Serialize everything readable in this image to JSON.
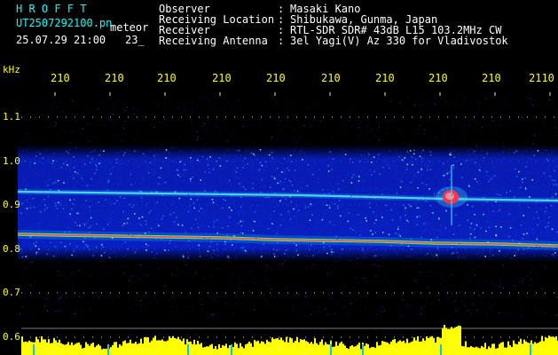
{
  "header": {
    "app_name": "H R O F F T",
    "filename": "UT2507292100.pn",
    "mode": "meteor",
    "datetime": "25.07.29 21:00",
    "extra": "23_",
    "fields": [
      {
        "label": "Observer",
        "sep": ":",
        "value": "Masaki Kano"
      },
      {
        "label": "Receiving Location",
        "sep": ":",
        "value": "Shibukawa, Gunma, Japan"
      },
      {
        "label": "Receiver",
        "sep": ":",
        "value": "RTL-SDR SDR# 43dB L15 103.2MHz CW"
      },
      {
        "label": "Receiving Antenna",
        "sep": ":",
        "value": "3el Yagi(V) Az 330 for Vladivostok"
      }
    ]
  },
  "axes": {
    "y_unit": "kHz",
    "y_ticks": [
      "1.1",
      "1.0",
      "0.9",
      "0.8",
      "0.7",
      "0.6"
    ],
    "x_ticks": [
      "210",
      "210",
      "210",
      "210",
      "210",
      "210",
      "210",
      "210",
      "210",
      "2110"
    ]
  },
  "colors": {
    "background": "#000000",
    "header_cyan": "#00ffff",
    "header_white": "#ffffff",
    "axis_yellow": "#ffff00",
    "noise_blue": "#0a1fd8",
    "signal_cyan": "#58f0ff",
    "signal_red": "#ff2a4c",
    "baseline": "#7a7a7a"
  }
}
